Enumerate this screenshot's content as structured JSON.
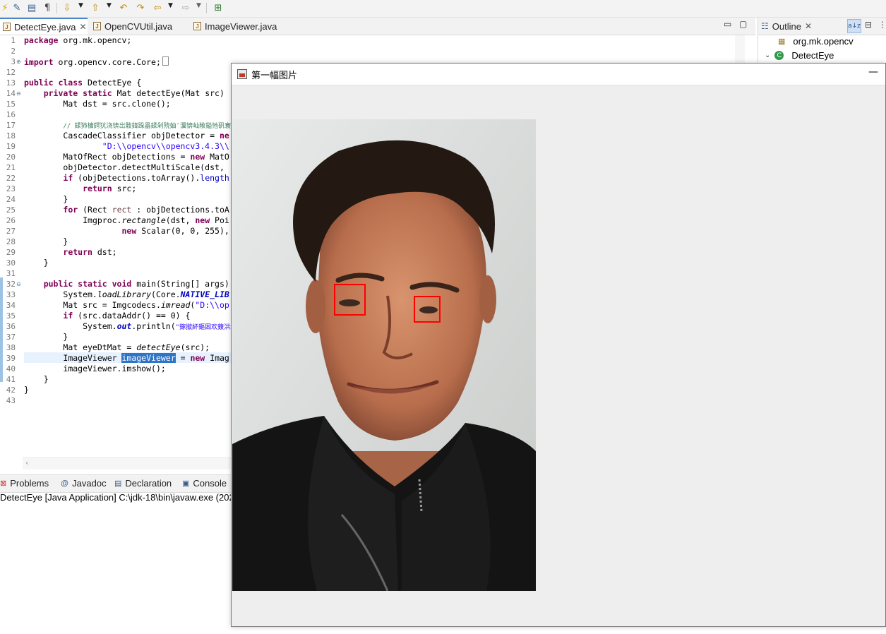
{
  "toolbar": {
    "icons": [
      "lightning-icon",
      "edit-icon",
      "page-icon",
      "pilcrow-icon",
      "next-annotation-icon",
      "previous-annotation-icon",
      "last-edit-icon",
      "back-icon",
      "forward-icon",
      "open-task-icon"
    ]
  },
  "editor": {
    "tabs": [
      {
        "label": "DetectEye.java",
        "active": true
      },
      {
        "label": "OpenCVUtil.java",
        "active": false
      },
      {
        "label": "ImageViewer.java",
        "active": false
      }
    ],
    "line_numbers": [
      "1",
      "2",
      "3",
      "12",
      "13",
      "14",
      "15",
      "16",
      "17",
      "18",
      "19",
      "20",
      "21",
      "22",
      "23",
      "24",
      "25",
      "26",
      "27",
      "28",
      "29",
      "30",
      "31",
      "32",
      "33",
      "34",
      "35",
      "36",
      "37",
      "38",
      "39",
      "40",
      "41",
      "42",
      "43"
    ],
    "lines": {
      "l1_kw": "package",
      "l1_rest": " org.mk.opencv;",
      "l3_kw": "import",
      "l3_rest": " org.opencv.core.Core;",
      "l13_kw": "public class",
      "l13_rest": " DetectEye {",
      "l14_kw": "private static",
      "l14_rest": " Mat detectEye(Mat src)",
      "l15": "Mat dst = src.clone();",
      "l17": "// 鍒犻櫎鍔犺浇锛岀敤鍏跺畾鍒剁殑妯″瀷锛屾敞鎰忚矾寰",
      "l18_a": "CascadeClassifier objDetector = ",
      "l18_kw": "ne",
      "l19": "\"D:\\\\opencv\\\\opencv3.4.3\\\\",
      "l20_a": "MatOfRect objDetections = ",
      "l20_kw": "new",
      "l20_b": " MatO",
      "l21": "objDetector.detectMultiScale(dst,",
      "l22_kw": "if",
      "l22_rest": " (objDetections.toArray().",
      "l22_fld": "length",
      "l23_kw": "return",
      "l23_rest": " src;",
      "l24": "}",
      "l25_kw": "for",
      "l25_rest": " (Rect ",
      "l25_var": "rect",
      "l25_rest2": " : objDetections.toA",
      "l26_a": "Imgproc.",
      "l26_itl": "rectangle",
      "l26_b": "(dst, ",
      "l26_kw": "new",
      "l26_c": " Poi",
      "l27_kw": "new",
      "l27_rest": " Scalar(0, 0, 255),",
      "l28": "}",
      "l29_kw": "return",
      "l29_rest": " dst;",
      "l30": "}",
      "l32_kw": "public static void",
      "l32_rest": " main(String[] args)",
      "l33_a": "System.",
      "l33_itl": "loadLibrary",
      "l33_b": "(Core.",
      "l33_fld": "NATIVE_LIB",
      "l34_a": "Mat src = Imgcodecs.",
      "l34_itl": "imread",
      "l34_b": "(",
      "l34_str": "\"D:\\\\op",
      "l35_kw": "if",
      "l35_rest": " (src.dataAddr() == 0) {",
      "l36_a": "System.",
      "l36_fld": "out",
      "l36_b": ".println(",
      "l36_str": "\"鎵撳紑鏂囦欢鍑洪敊\"",
      "l36_c": ")",
      "l37": "}",
      "l38_a": "Mat eyeDtMat = ",
      "l38_itl": "detectEye",
      "l38_b": "(src);",
      "l39_a": "ImageViewer ",
      "l39_sel": "imageViewer",
      "l39_b": " = ",
      "l39_kw": "new",
      "l39_c": " Imag",
      "l40": "imageViewer.imshow();",
      "l41": "}",
      "l42": "}"
    }
  },
  "outline": {
    "title": "Outline",
    "items": [
      {
        "label": "org.mk.opencv"
      },
      {
        "label": "DetectEye"
      }
    ]
  },
  "bottom_panel": {
    "tabs": [
      {
        "label": "Problems"
      },
      {
        "label": "Javadoc"
      },
      {
        "label": "Declaration"
      },
      {
        "label": "Console"
      }
    ],
    "console_text": "DetectEye [Java Application] C:\\jdk-18\\bin\\javaw.exe  (202"
  },
  "image_window": {
    "title": "第一幅图片"
  },
  "colors": {
    "accent": "#4a86c5",
    "keyword": "#7f0055",
    "string": "#2a00ff",
    "comment": "#3f7f5f",
    "detection_box": "#ff0000"
  }
}
